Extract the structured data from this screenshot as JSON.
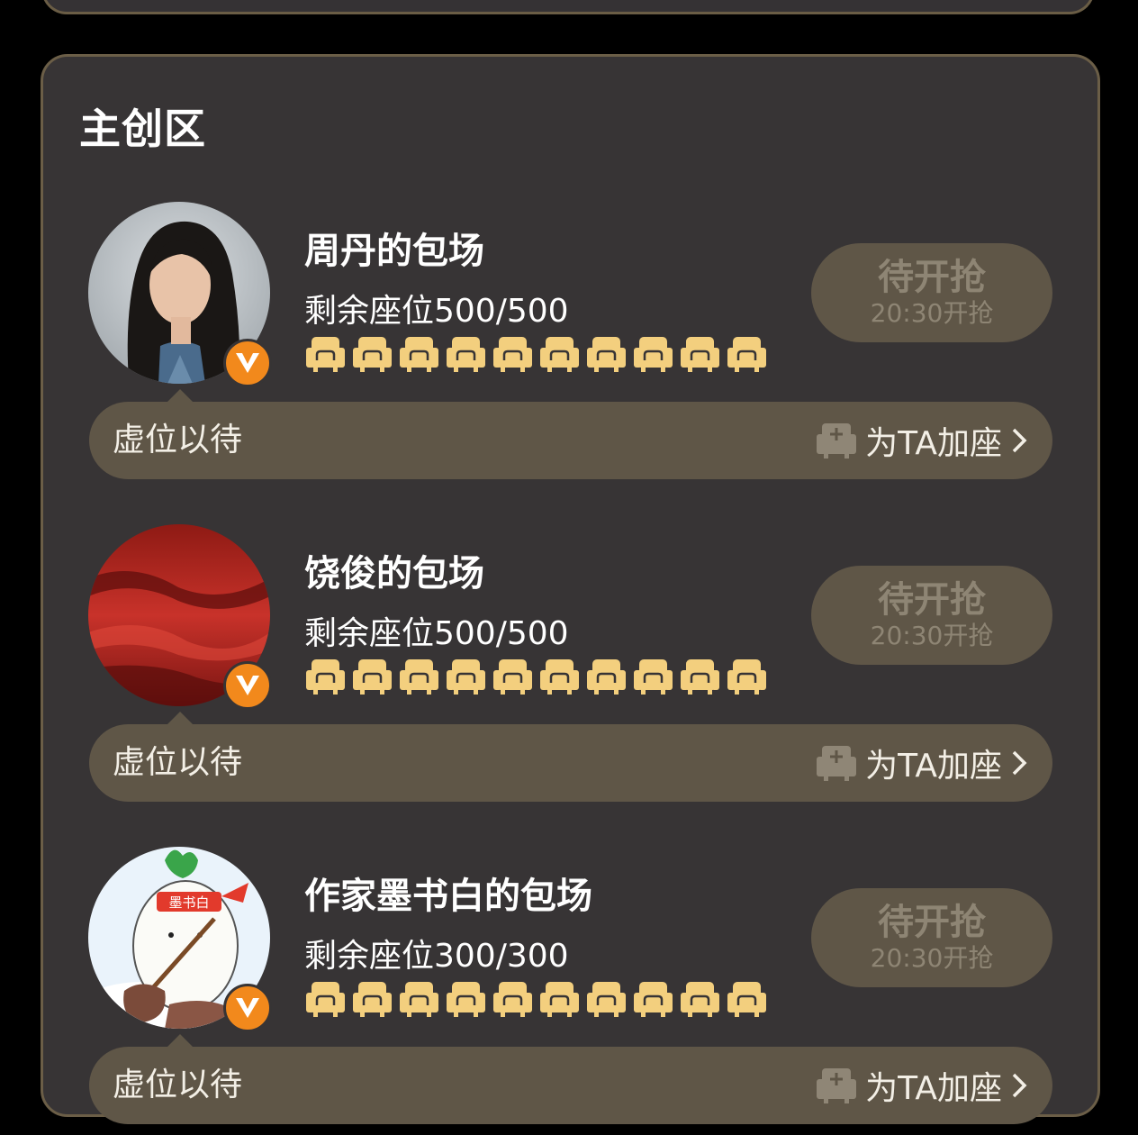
{
  "section": {
    "title": "主创区"
  },
  "colors": {
    "accent": "#f2891c",
    "seat": "#f3cf7e",
    "button_bg": "#5f5647",
    "panel_bg": "#373435"
  },
  "entries": [
    {
      "name": "周丹的包场",
      "seats": "剩余座位500/500",
      "grab_title": "待开抢",
      "grab_time": "20:30开抢",
      "bar_left": "虚位以待",
      "bar_right": "为TA加座",
      "avatar": "woman-portrait-photo"
    },
    {
      "name": "饶俊的包场",
      "seats": "剩余座位500/500",
      "grab_title": "待开抢",
      "grab_time": "20:30开抢",
      "bar_left": "虚位以待",
      "bar_right": "为TA加座",
      "avatar": "red-sky-photo"
    },
    {
      "name": "作家墨书白的包场",
      "seats": "剩余座位300/300",
      "grab_title": "待开抢",
      "grab_time": "20:30开抢",
      "bar_left": "虚位以待",
      "bar_right": "为TA加座",
      "avatar": "radish-cartoon",
      "avatar_text": "墨书白"
    }
  ],
  "icons": [
    "v-badge-icon",
    "seat-icon",
    "add-seat-icon",
    "chevron-right-icon"
  ]
}
